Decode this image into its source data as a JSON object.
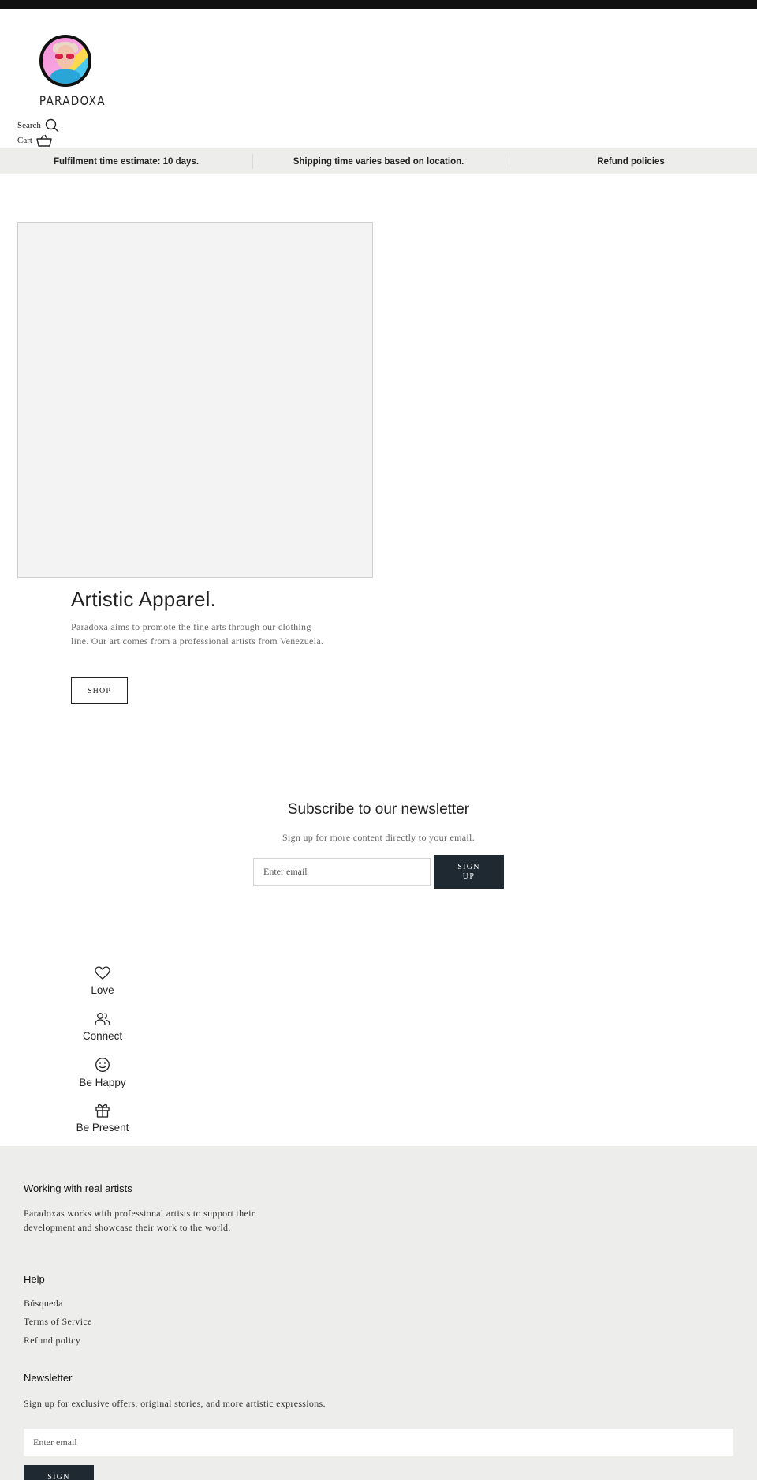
{
  "brand": {
    "name": "PARADOXA"
  },
  "header": {
    "search_label": "Search",
    "cart_label": "Cart"
  },
  "announcements": [
    "Fulfilment time estimate: 10 days.",
    "Shipping time varies based on location.",
    "Refund policies"
  ],
  "hero": {
    "title": "Artistic Apparel.",
    "text": "Paradoxa aims to promote the fine arts through our clothing line. Our art comes from a professional artists from Venezuela.",
    "button": "SHOP"
  },
  "newsletter": {
    "title": "Subscribe to our newsletter",
    "subtitle": "Sign up for more content directly to your email.",
    "placeholder": "Enter email",
    "button": "SIGN UP"
  },
  "features": [
    {
      "label": "Love",
      "icon": "heart-icon"
    },
    {
      "label": "Connect",
      "icon": "users-icon"
    },
    {
      "label": "Be Happy",
      "icon": "smile-icon"
    },
    {
      "label": "Be Present",
      "icon": "gift-icon"
    }
  ],
  "footer": {
    "about_title": "Working with real artists",
    "about_text": "Paradoxas works with professional artists to support their development and showcase their work to the world.",
    "help_title": "Help",
    "help_links": [
      "Búsqueda",
      "Terms of Service",
      "Refund policy"
    ],
    "newsletter_title": "Newsletter",
    "newsletter_text": "Sign up for exclusive offers, original stories, and more artistic expressions.",
    "newsletter_placeholder": "Enter email",
    "newsletter_button": "SIGN"
  },
  "colors": {
    "dark_button": "#1f2932",
    "announcement_bg": "#ededeb",
    "footer_bg": "#ededeb"
  }
}
